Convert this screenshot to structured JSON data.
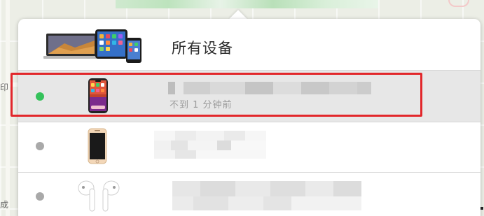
{
  "map": {
    "left_labels": [
      "印",
      "成"
    ]
  },
  "device_list": {
    "all_devices_label": "所有设备",
    "items": [
      {
        "status": "online",
        "status_color": "#35c25b",
        "icon": "iphone-icon",
        "last_seen": "不到 1 分钟前",
        "highlighted": true
      },
      {
        "status": "offline",
        "status_color": "#a9a9a9",
        "icon": "iphone-gold-icon"
      },
      {
        "status": "offline",
        "status_color": "#a9a9a9",
        "icon": "airpods-icon"
      }
    ]
  },
  "colors": {
    "highlight": "#e2272b",
    "online": "#35c25b",
    "offline": "#a9a9a9"
  }
}
